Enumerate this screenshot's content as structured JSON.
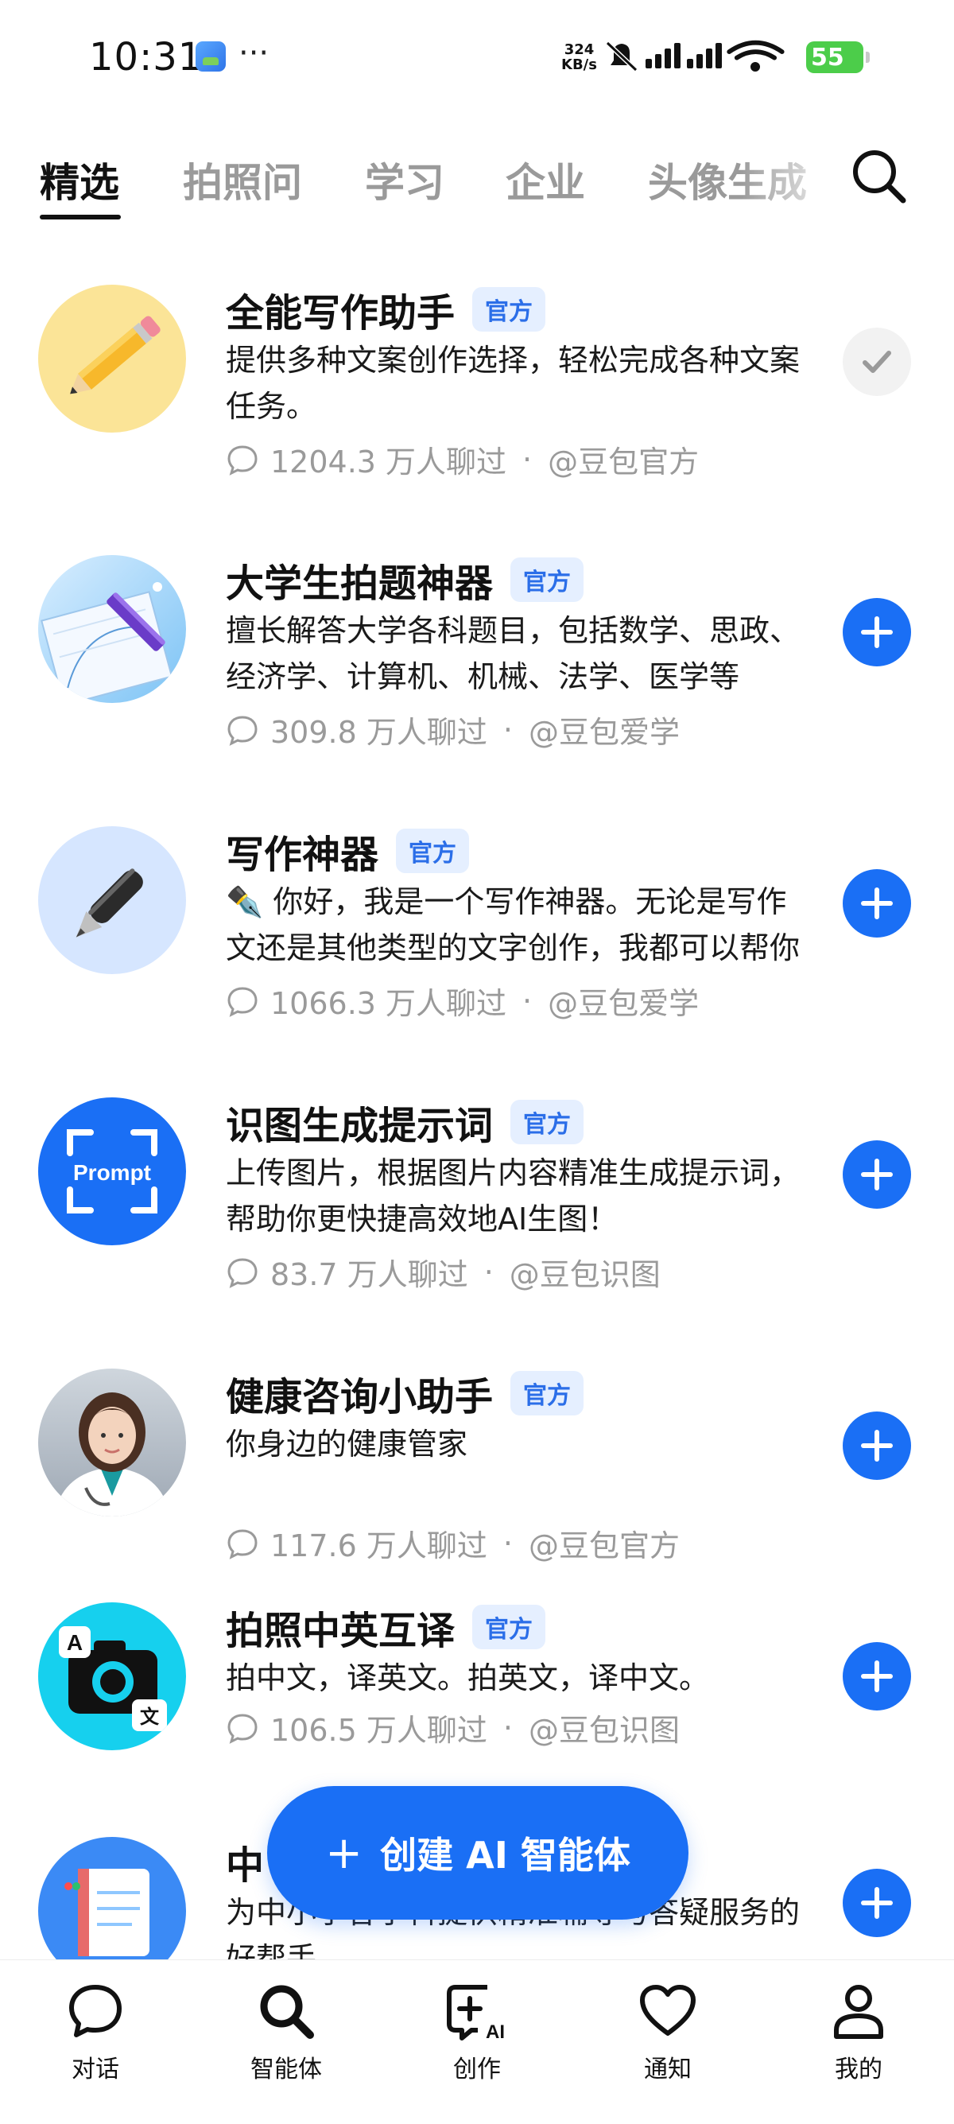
{
  "status_bar": {
    "time": "10:31",
    "dots": "···",
    "net_speed_value": "324",
    "net_speed_unit": "KB/s",
    "battery": "55"
  },
  "tabs": [
    {
      "label": "精选",
      "active": true
    },
    {
      "label": "拍照问",
      "active": false
    },
    {
      "label": "学习",
      "active": false
    },
    {
      "label": "企业",
      "active": false
    },
    {
      "label": "头像生成",
      "active": false
    }
  ],
  "items": [
    {
      "title": "全能写作助手",
      "badge": "官方",
      "desc": "提供多种文案创作选择，轻松完成各种文案任务。",
      "chats": "1204.3 万人聊过",
      "author": "@豆包官方",
      "added": true
    },
    {
      "title": "大学生拍题神器",
      "badge": "官方",
      "desc": "擅长解答大学各科题目，包括数学、思政、经济学、计算机、机械、法学、医学等",
      "chats": "309.8 万人聊过",
      "author": "@豆包爱学",
      "added": false
    },
    {
      "title": "写作神器",
      "badge": "官方",
      "desc": "✒️ 你好，我是一个写作神器。无论是写作文还是其他类型的文字创作，我都可以帮你",
      "chats": "1066.3 万人聊过",
      "author": "@豆包爱学",
      "added": false
    },
    {
      "title": "识图生成提示词",
      "badge": "官方",
      "desc": "上传图片，根据图片内容精准生成提示词，帮助你更快捷高效地AI生图！",
      "chats": "83.7 万人聊过",
      "author": "@豆包识图",
      "added": false,
      "avatar_text": "Prompt"
    },
    {
      "title": "健康咨询小助手",
      "badge": "官方",
      "desc": "你身边的健康管家",
      "chats": "117.6 万人聊过",
      "author": "@豆包官方",
      "added": false
    },
    {
      "title": "拍照中英互译",
      "badge": "官方",
      "desc": "拍中文，译英文。拍英文，译中文。",
      "chats": "106.5 万人聊过",
      "author": "@豆包识图",
      "added": false,
      "avatar_letters": [
        "A",
        "文"
      ]
    },
    {
      "title": "中",
      "badge": "",
      "desc": "为中小学各学科提供精准辅导与答疑服务的好帮手",
      "chats": "",
      "author": "",
      "added": false
    }
  ],
  "fab": {
    "plus": "+",
    "label": "创建 AI 智能体"
  },
  "bottom_nav": [
    {
      "label": "对话",
      "icon": "chat-bubble-icon"
    },
    {
      "label": "智能体",
      "icon": "search-icon"
    },
    {
      "label": "创作",
      "icon": "create-ai-icon"
    },
    {
      "label": "通知",
      "icon": "heart-icon"
    },
    {
      "label": "我的",
      "icon": "person-icon"
    }
  ],
  "colors": {
    "accent": "#1a6ff5",
    "badge_bg": "#e5efff",
    "badge_text": "#2b6ee8",
    "muted": "#9a9a9a"
  }
}
